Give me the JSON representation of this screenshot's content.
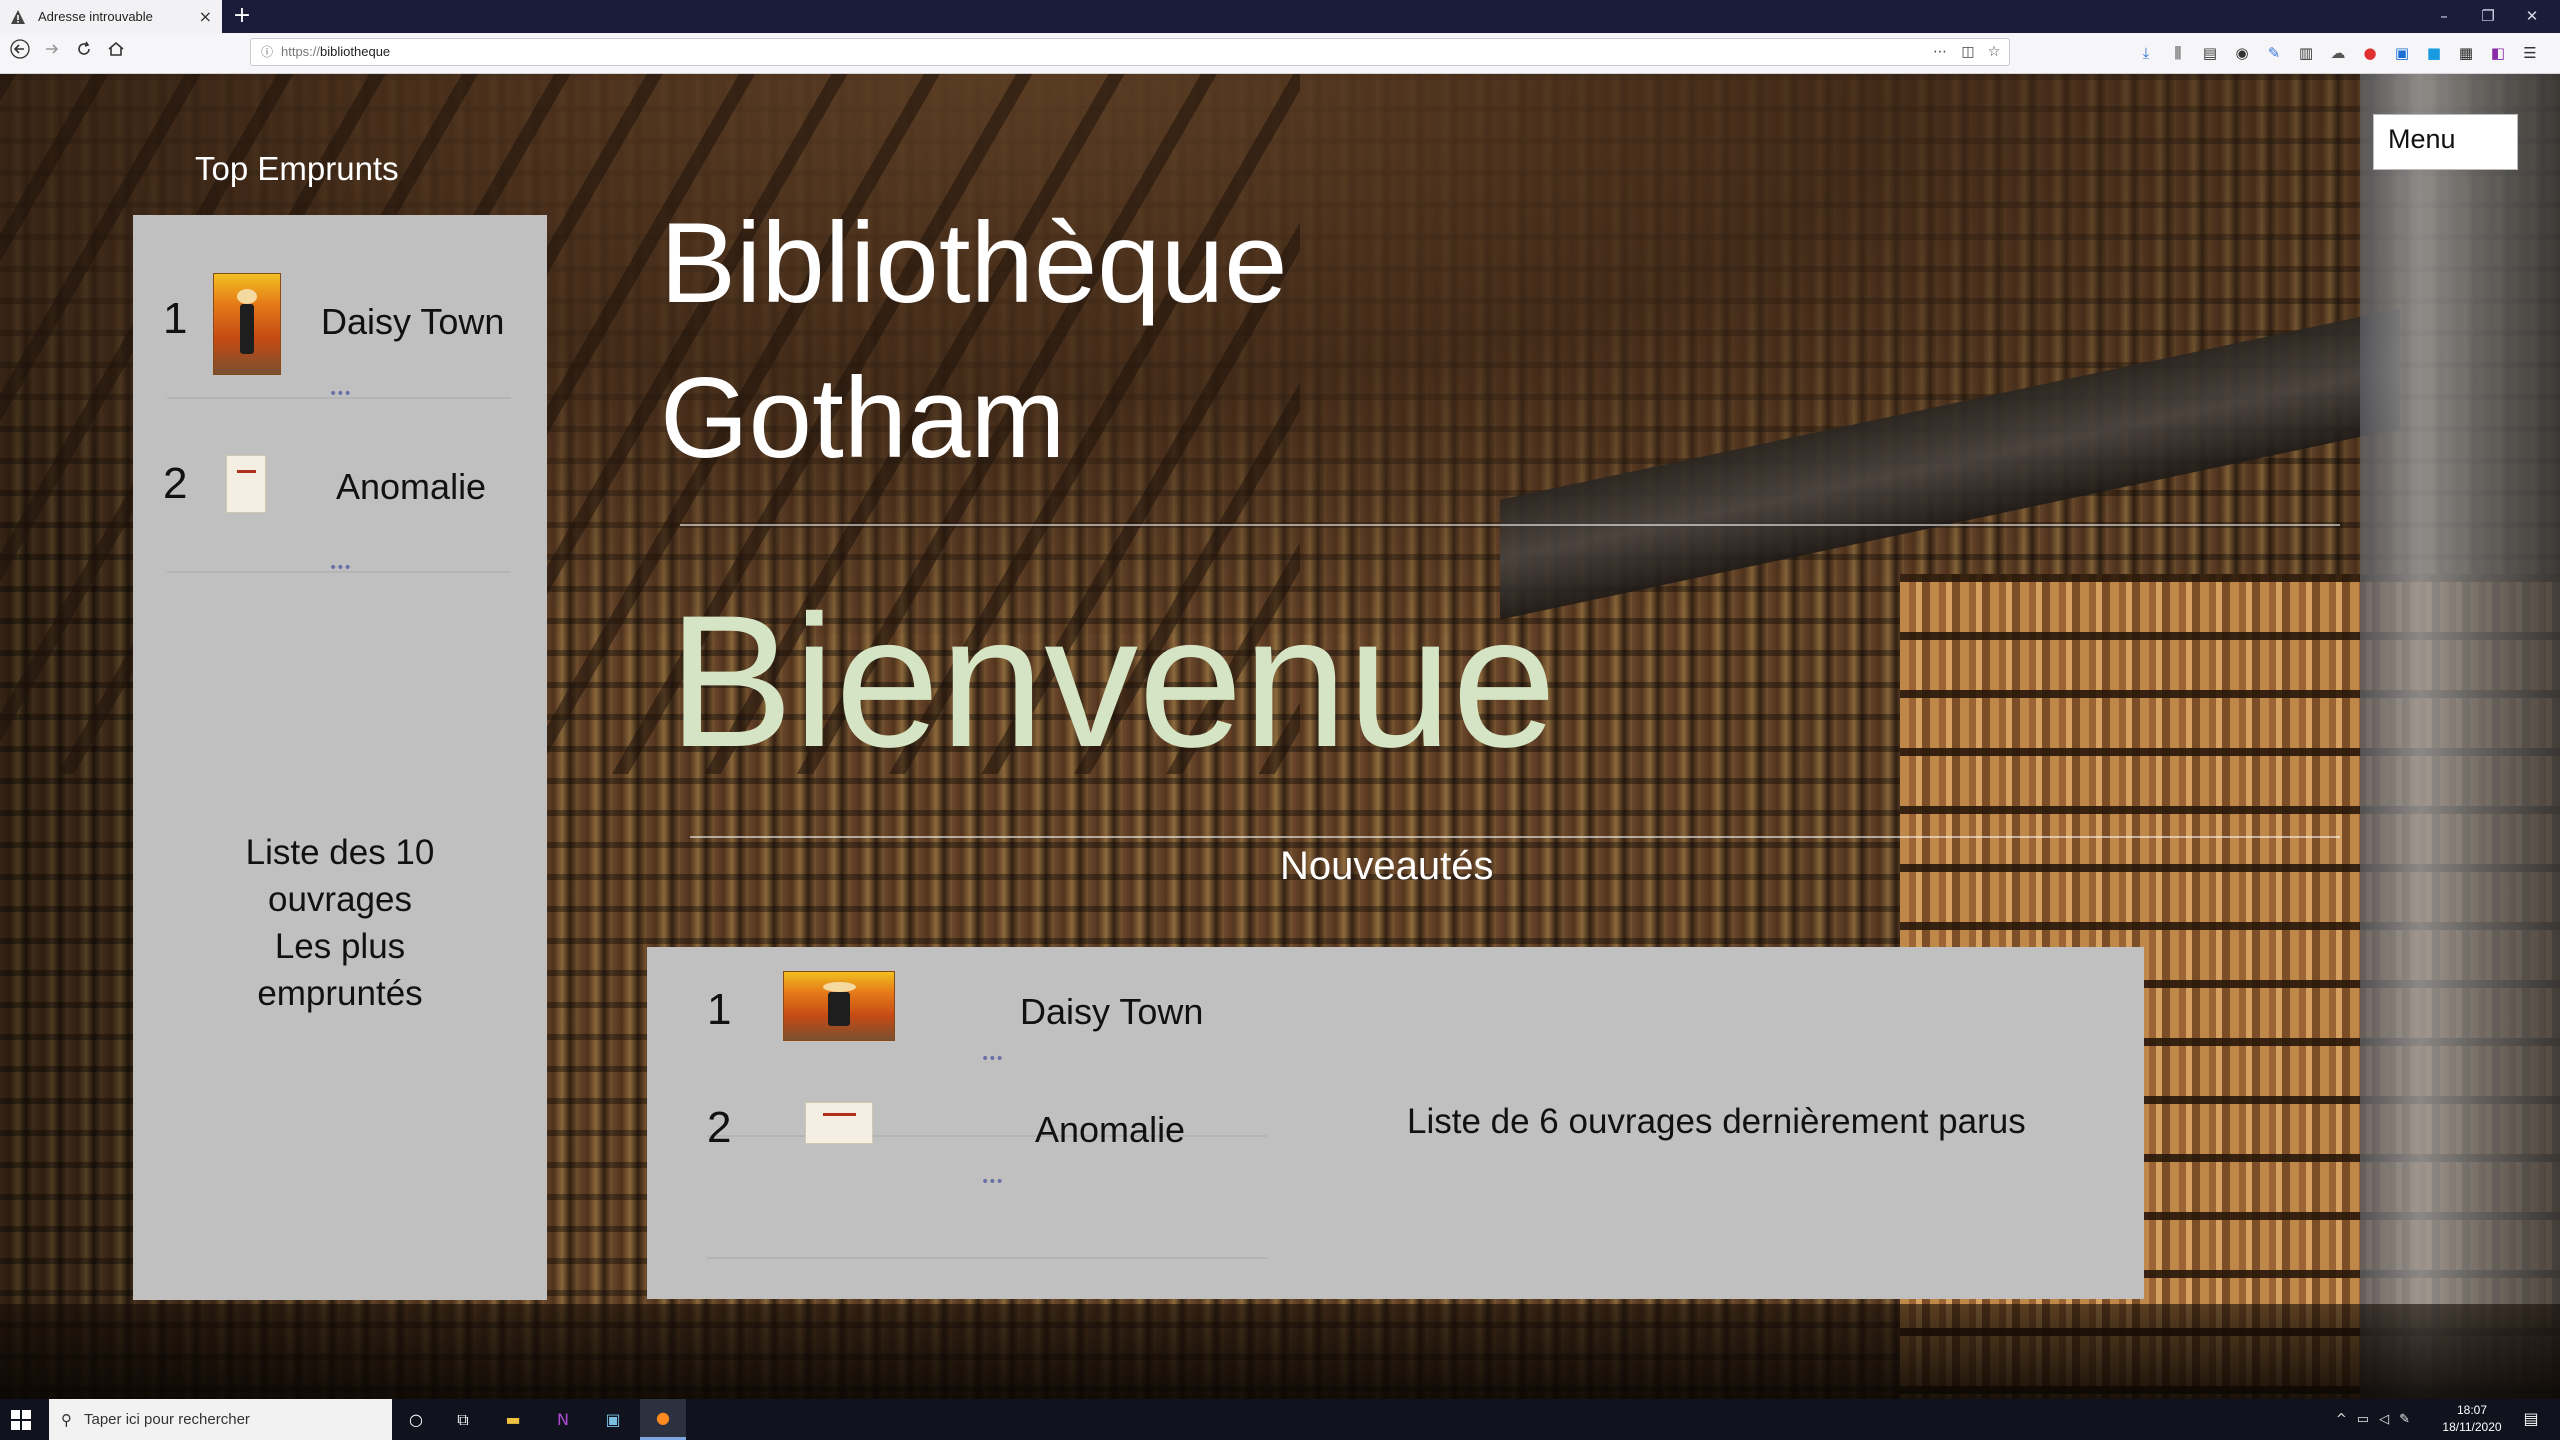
{
  "browser": {
    "tab_title": "Adresse introuvable",
    "tab_close": "×",
    "new_tab": "+",
    "url_prefix": "https://",
    "url_host": "bibliotheque",
    "window_controls": [
      "–",
      "❐",
      "✕"
    ]
  },
  "page": {
    "top_title": "Top Emprunts",
    "top_list": [
      {
        "rank": "1",
        "title": "Daisy Town",
        "cover": "lucky-luke-cover"
      },
      {
        "rank": "2",
        "title": "Anomalie",
        "cover": "anomalie-cover"
      }
    ],
    "top_desc": [
      "Liste des 10",
      "ouvrages",
      "Les plus",
      "empruntés"
    ],
    "hero_line1": "Bibliothèque",
    "hero_line2": "Gotham",
    "welcome": "Bienvenue",
    "news_title": "Nouveautés",
    "news_list": [
      {
        "rank": "1",
        "title": "Daisy Town",
        "cover": "lucky-luke-cover"
      },
      {
        "rank": "2",
        "title": "Anomalie",
        "cover": "anomalie-cover"
      }
    ],
    "news_desc": "Liste de 6 ouvrages dernièrement parus",
    "menu_label": "Menu",
    "divider_dots": "•••"
  },
  "taskbar": {
    "search_placeholder": "Taper ici pour rechercher",
    "time": "18:07",
    "date": "18/11/2020"
  },
  "colors": {
    "accent_welcome": "#d5e4c4",
    "panel_bg": "#c0c0c0",
    "tabbar_bg": "#1a1c3a",
    "taskbar_bg": "#10131e"
  }
}
